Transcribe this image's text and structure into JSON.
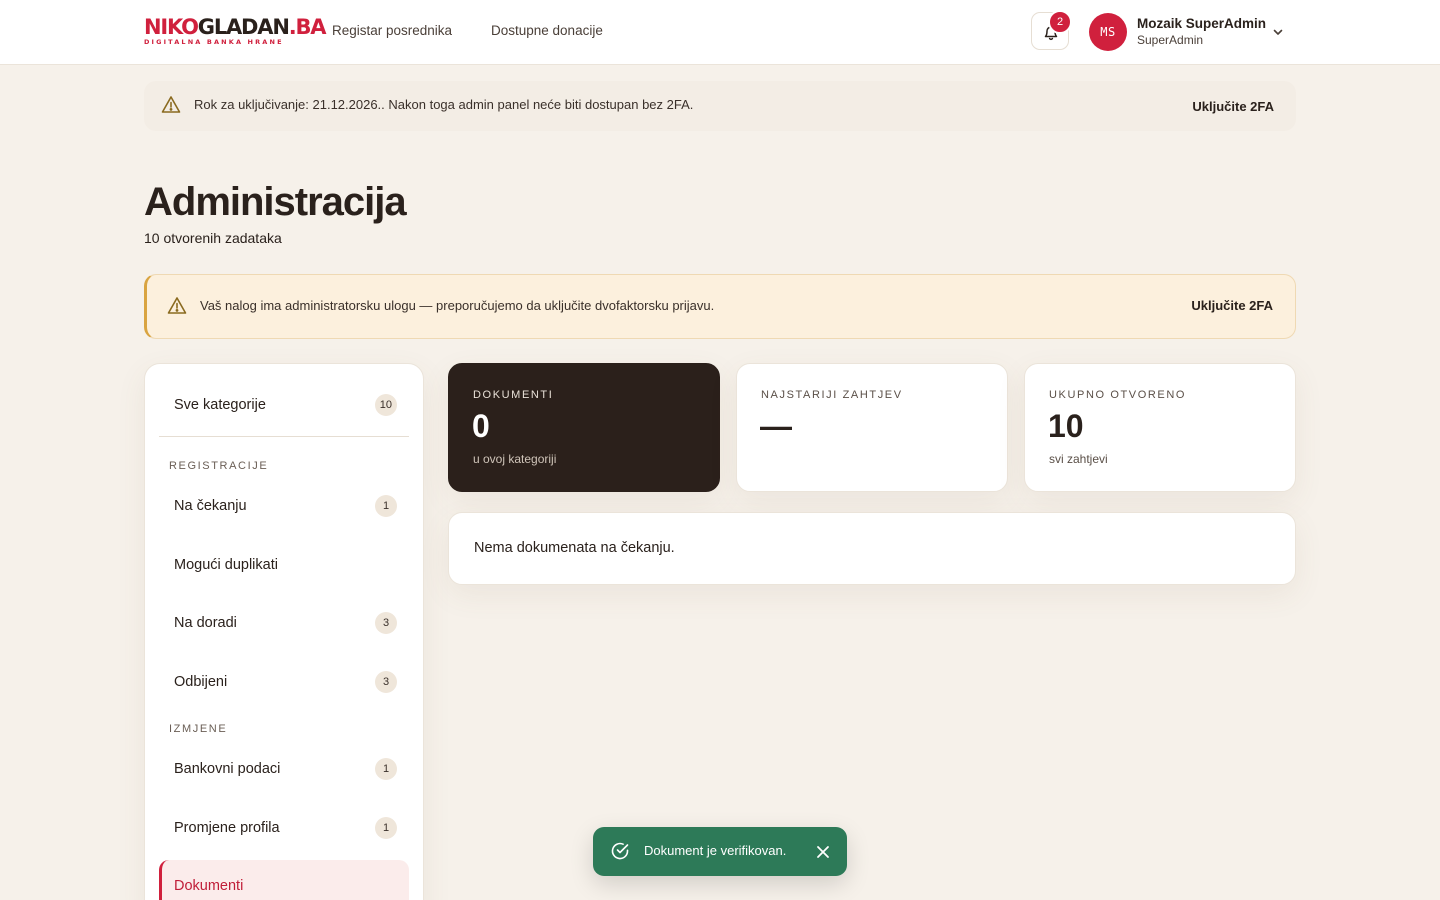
{
  "header": {
    "logo": {
      "part1": "NIKO",
      "part2": "GLADAN",
      "part3": ".BA",
      "tagline": "DIGITALNA BANKA HRANE"
    },
    "nav": [
      {
        "label": "Registar posrednika"
      },
      {
        "label": "Dostupne donacije"
      }
    ],
    "notifications": {
      "count": "2",
      "icon": "bell-icon"
    },
    "user": {
      "initials": "MS",
      "name": "Mozaik SuperAdmin",
      "role": "SuperAdmin"
    }
  },
  "top_banner": {
    "message": "Rok za uključivanje: 21.12.2026.. Nakon toga admin panel neće biti dostupan bez 2FA.",
    "action": "Uključite 2FA"
  },
  "page": {
    "title": "Administracija",
    "subtitle": "10 otvorenih zadataka"
  },
  "warning_banner": {
    "message": "Vaš nalog ima administratorsku ulogu — preporučujemo da uključite dvofaktorsku prijavu.",
    "action": "Uključite 2FA"
  },
  "sidebar": {
    "all": {
      "label": "Sve kategorije",
      "count": "10"
    },
    "sections": [
      {
        "title": "REGISTRACIJE",
        "items": [
          {
            "label": "Na čekanju",
            "count": "1"
          },
          {
            "label": "Mogući duplikati",
            "count": ""
          },
          {
            "label": "Na doradi",
            "count": "3"
          },
          {
            "label": "Odbijeni",
            "count": "3"
          }
        ]
      },
      {
        "title": "IZMJENE",
        "items": [
          {
            "label": "Bankovni podaci",
            "count": "1"
          },
          {
            "label": "Promjene profila",
            "count": "1"
          },
          {
            "label": "Dokumenti",
            "count": "",
            "active": true
          }
        ]
      }
    ]
  },
  "stats": [
    {
      "key": "DOKUMENTI",
      "value": "0",
      "sub": "u ovoj kategoriji"
    },
    {
      "key": "NAJSTARIJI ZAHTJEV",
      "value": "—",
      "sub": ""
    },
    {
      "key": "UKUPNO OTVORENO",
      "value": "10",
      "sub": "svi zahtjevi"
    }
  ],
  "empty_state": {
    "message": "Nema dokumenata na čekanju."
  },
  "toast": {
    "message": "Dokument je verifikovan.",
    "icon": "check-circle-icon"
  },
  "colors": {
    "brand_red": "#d0203d",
    "dark_card": "#2b201b",
    "toast_green": "#2d7a58",
    "warning_border": "#d9a441"
  }
}
